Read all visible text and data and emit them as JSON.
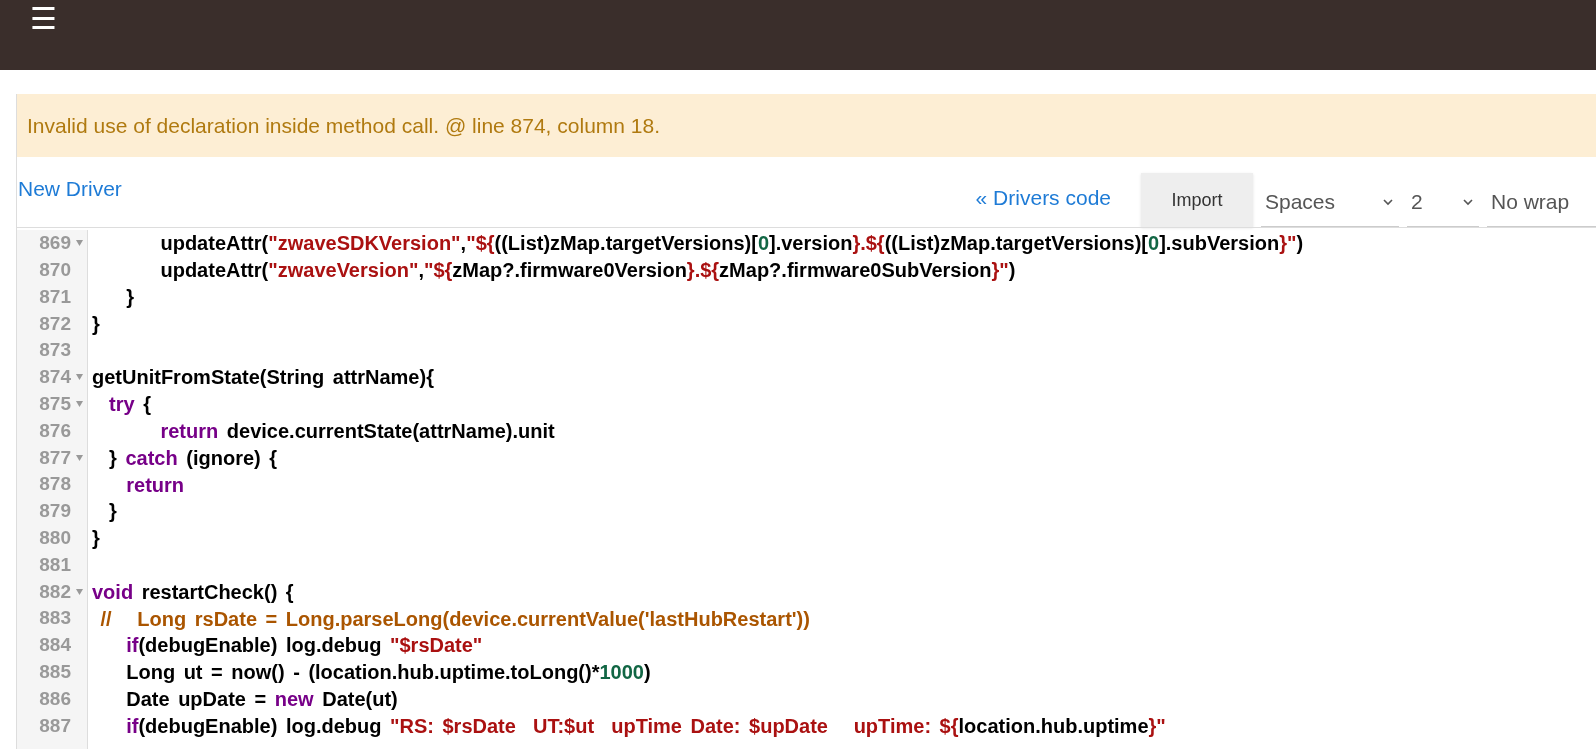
{
  "header": {
    "menu_icon": "☰"
  },
  "alert": {
    "message": "Invalid use of declaration inside method call. @ line 874, column 18."
  },
  "toolbar": {
    "new_link": "New Driver",
    "back_link": "« Drivers code",
    "import_button": "Import",
    "indent_type": "Spaces",
    "indent_size": "2",
    "wrap": "No wrap"
  },
  "lines": [
    {
      "number": "869",
      "foldable": true,
      "tokens": [
        {
          "kind": "plain",
          "text": "        updateAttr("
        },
        {
          "kind": "string",
          "text": "\"zwaveSDKVersion\""
        },
        {
          "kind": "plain",
          "text": ","
        },
        {
          "kind": "string",
          "text": "\"${"
        },
        {
          "kind": "plain",
          "text": "((List)zMap.targetVersions)["
        },
        {
          "kind": "number",
          "text": "0"
        },
        {
          "kind": "plain",
          "text": "].version"
        },
        {
          "kind": "string",
          "text": "}.${"
        },
        {
          "kind": "plain",
          "text": "((List)zMap.targetVersions)["
        },
        {
          "kind": "number",
          "text": "0"
        },
        {
          "kind": "plain",
          "text": "].subVersion"
        },
        {
          "kind": "string",
          "text": "}\""
        },
        {
          "kind": "plain",
          "text": ")"
        }
      ]
    },
    {
      "number": "870",
      "foldable": false,
      "tokens": [
        {
          "kind": "plain",
          "text": "        updateAttr("
        },
        {
          "kind": "string",
          "text": "\"zwaveVersion\""
        },
        {
          "kind": "plain",
          "text": ","
        },
        {
          "kind": "string",
          "text": "\"${"
        },
        {
          "kind": "plain",
          "text": "zMap?.firmware0Version"
        },
        {
          "kind": "string",
          "text": "}.${"
        },
        {
          "kind": "plain",
          "text": "zMap?.firmware0SubVersion"
        },
        {
          "kind": "string",
          "text": "}\""
        },
        {
          "kind": "plain",
          "text": ")"
        }
      ]
    },
    {
      "number": "871",
      "foldable": false,
      "tokens": [
        {
          "kind": "plain",
          "text": "    }"
        }
      ]
    },
    {
      "number": "872",
      "foldable": false,
      "tokens": [
        {
          "kind": "plain",
          "text": "}"
        }
      ]
    },
    {
      "number": "873",
      "foldable": false
    },
    {
      "number": "874",
      "foldable": true,
      "tokens": [
        {
          "kind": "plain",
          "text": "getUnitFromState(String attrName){"
        }
      ]
    },
    {
      "number": "875",
      "foldable": true,
      "tokens": [
        {
          "kind": "keyword",
          "text": "  try"
        },
        {
          "kind": "plain",
          "text": " {"
        }
      ]
    },
    {
      "number": "876",
      "foldable": false,
      "tokens": [
        {
          "kind": "keyword",
          "text": "        return"
        },
        {
          "kind": "plain",
          "text": " device.currentState(attrName).unit"
        }
      ]
    },
    {
      "number": "877",
      "foldable": true,
      "tokens": [
        {
          "kind": "plain",
          "text": "  } "
        },
        {
          "kind": "keyword",
          "text": "catch"
        },
        {
          "kind": "plain",
          "text": " (ignore) {"
        }
      ]
    },
    {
      "number": "878",
      "foldable": false,
      "tokens": [
        {
          "kind": "keyword",
          "text": "    return"
        }
      ]
    },
    {
      "number": "879",
      "foldable": false,
      "tokens": [
        {
          "kind": "plain",
          "text": "  }"
        }
      ]
    },
    {
      "number": "880",
      "foldable": false,
      "tokens": [
        {
          "kind": "plain",
          "text": "}"
        }
      ]
    },
    {
      "number": "881",
      "foldable": false
    },
    {
      "number": "882",
      "foldable": true,
      "tokens": [
        {
          "kind": "keyword",
          "text": "void"
        },
        {
          "kind": "plain",
          "text": " restartCheck() {"
        }
      ]
    },
    {
      "number": "883",
      "foldable": false,
      "tokens": [
        {
          "kind": "comment",
          "text": " //   Long rsDate = Long.parseLong(device.currentValue('lastHubRestart'))"
        }
      ]
    },
    {
      "number": "884",
      "foldable": false,
      "tokens": [
        {
          "kind": "keyword",
          "text": "    if"
        },
        {
          "kind": "plain",
          "text": "(debugEnable) log.debug "
        },
        {
          "kind": "string",
          "text": "\"$rsDate\""
        }
      ]
    },
    {
      "number": "885",
      "foldable": false,
      "tokens": [
        {
          "kind": "plain",
          "text": "    Long ut = now() - (location.hub.uptime.toLong()*"
        },
        {
          "kind": "number",
          "text": "1000"
        },
        {
          "kind": "plain",
          "text": ")"
        }
      ]
    },
    {
      "number": "886",
      "foldable": false,
      "tokens": [
        {
          "kind": "plain",
          "text": "    Date upDate = "
        },
        {
          "kind": "keyword",
          "text": "new"
        },
        {
          "kind": "plain",
          "text": " Date(ut)"
        }
      ]
    },
    {
      "number": "887",
      "foldable": false,
      "tokens": [
        {
          "kind": "keyword",
          "text": "    if"
        },
        {
          "kind": "plain",
          "text": "(debugEnable) log.debug "
        },
        {
          "kind": "string",
          "text": "\"RS: $rsDate  UT:$ut  upTime Date: $upDate   upTime: ${"
        },
        {
          "kind": "plain",
          "text": "location.hub.uptime"
        },
        {
          "kind": "string",
          "text": "}\""
        }
      ]
    }
  ]
}
